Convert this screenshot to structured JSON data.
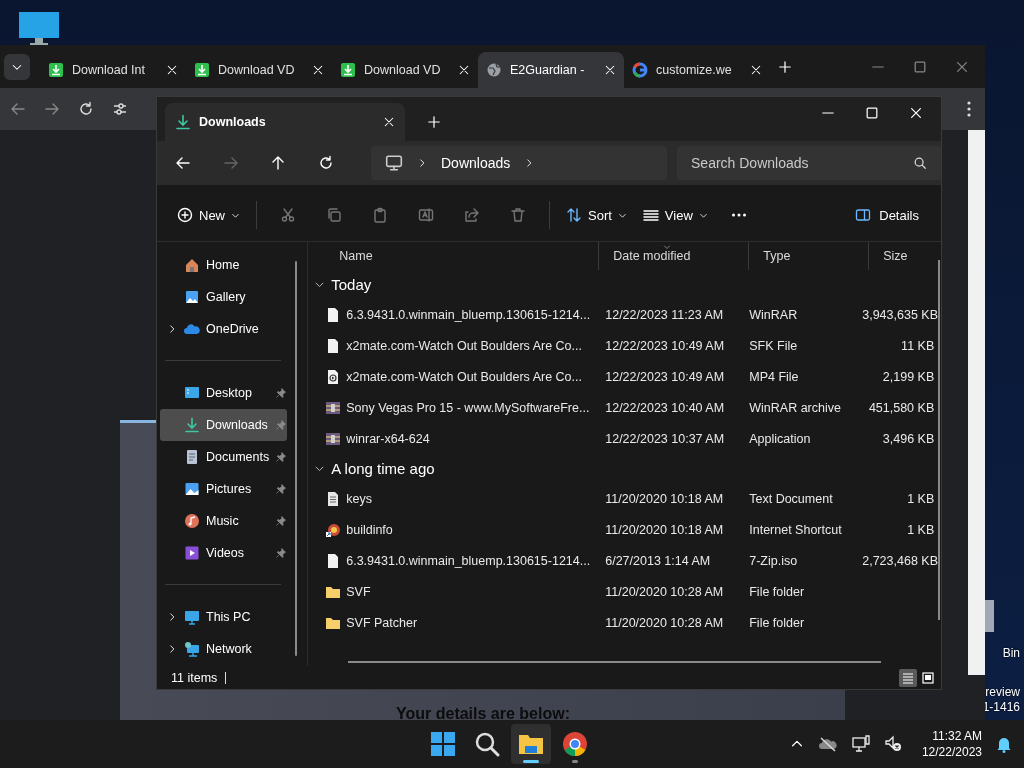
{
  "desktop": {
    "icon_labels": [
      "Bin",
      "review",
      "1-1416"
    ]
  },
  "browser": {
    "tabs": [
      {
        "title": "Download Int",
        "kind": "download",
        "selected": false
      },
      {
        "title": "Download VD",
        "kind": "download",
        "selected": false
      },
      {
        "title": "Download VD",
        "kind": "download",
        "selected": false
      },
      {
        "title": "E2Guardian - ",
        "kind": "globe",
        "selected": true
      },
      {
        "title": "customize.we",
        "kind": "google",
        "selected": false
      }
    ],
    "page_text": "Your details are below:"
  },
  "explorer": {
    "tab": {
      "title": "Downloads"
    },
    "breadcrumb": [
      "Downloads"
    ],
    "search": {
      "placeholder": "Search Downloads"
    },
    "command_groups": [
      [
        {
          "kind": "new",
          "label": "New",
          "disabled": false
        }
      ],
      [
        {
          "kind": "cut",
          "disabled": true
        },
        {
          "kind": "copy",
          "disabled": true
        },
        {
          "kind": "paste",
          "disabled": true
        },
        {
          "kind": "rename",
          "disabled": true
        },
        {
          "kind": "share",
          "disabled": true
        },
        {
          "kind": "delete",
          "disabled": true
        }
      ],
      [
        {
          "kind": "sort",
          "label": "Sort",
          "disabled": false
        },
        {
          "kind": "view",
          "label": "View",
          "disabled": false
        },
        {
          "kind": "more",
          "disabled": false
        }
      ]
    ],
    "details_button": {
      "label": "Details"
    },
    "sidebar": [
      [
        {
          "label": "Home",
          "kind": "home",
          "expandable": false,
          "pinned": false,
          "selected": false
        },
        {
          "label": "Gallery",
          "kind": "gallery",
          "expandable": false,
          "pinned": false,
          "selected": false
        },
        {
          "label": "OneDrive",
          "kind": "cloud",
          "expandable": true,
          "pinned": false,
          "selected": false
        }
      ],
      [
        {
          "label": "Desktop",
          "kind": "desktop",
          "expandable": false,
          "pinned": true,
          "selected": false
        },
        {
          "label": "Downloads",
          "kind": "download",
          "expandable": false,
          "pinned": true,
          "selected": true
        },
        {
          "label": "Documents",
          "kind": "documents",
          "expandable": false,
          "pinned": true,
          "selected": false
        },
        {
          "label": "Pictures",
          "kind": "pictures",
          "expandable": false,
          "pinned": true,
          "selected": false
        },
        {
          "label": "Music",
          "kind": "music",
          "expandable": false,
          "pinned": true,
          "selected": false
        },
        {
          "label": "Videos",
          "kind": "videos",
          "expandable": false,
          "pinned": true,
          "selected": false
        }
      ],
      [
        {
          "label": "This PC",
          "kind": "pc",
          "expandable": true,
          "pinned": false,
          "selected": false
        },
        {
          "label": "Network",
          "kind": "network",
          "expandable": true,
          "pinned": false,
          "selected": false
        }
      ]
    ],
    "columns": [
      {
        "label": "Name",
        "sorted": false
      },
      {
        "label": "Date modified",
        "sorted": true
      },
      {
        "label": "Type",
        "sorted": false
      },
      {
        "label": "Size",
        "sorted": false
      }
    ],
    "groups": [
      {
        "label": "Today",
        "expanded": true,
        "rows": [
          {
            "kind": "file",
            "name": "6.3.9431.0.winmain_bluemp.130615-1214...",
            "date": "12/22/2023 11:23 AM",
            "type": "WinRAR",
            "size": "3,943,635 KB"
          },
          {
            "kind": "file",
            "name": "x2mate.com-Watch Out Boulders Are Co...",
            "date": "12/22/2023 10:49 AM",
            "type": "SFK File",
            "size": "11 KB"
          },
          {
            "kind": "video",
            "name": "x2mate.com-Watch Out Boulders Are Co...",
            "date": "12/22/2023 10:49 AM",
            "type": "MP4 File",
            "size": "2,199 KB"
          },
          {
            "kind": "archive",
            "name": "Sony Vegas Pro 15 - www.MySoftwareFre...",
            "date": "12/22/2023 10:40 AM",
            "type": "WinRAR archive",
            "size": "451,580 KB"
          },
          {
            "kind": "archive",
            "name": "winrar-x64-624",
            "date": "12/22/2023 10:37 AM",
            "type": "Application",
            "size": "3,496 KB"
          }
        ]
      },
      {
        "label": "A long time ago",
        "expanded": true,
        "rows": [
          {
            "kind": "text",
            "name": "keys",
            "date": "11/20/2020 10:18 AM",
            "type": "Text Document",
            "size": "1 KB"
          },
          {
            "kind": "shortcut",
            "name": "buildinfo",
            "date": "11/20/2020 10:18 AM",
            "type": "Internet Shortcut",
            "size": "1 KB"
          },
          {
            "kind": "file",
            "name": "6.3.9431.0.winmain_bluemp.130615-1214...",
            "date": "6/27/2013 1:14 AM",
            "type": "7-Zip.iso",
            "size": "2,723,468 KB"
          },
          {
            "kind": "folder",
            "name": "SVF",
            "date": "11/20/2020 10:28 AM",
            "type": "File folder"
          },
          {
            "kind": "folder",
            "name": "SVF Patcher",
            "date": "11/20/2020 10:28 AM",
            "type": "File folder"
          }
        ]
      }
    ],
    "status": "11 items",
    "view_modes": [
      {
        "kind": "details",
        "selected": true
      },
      {
        "kind": "tiles",
        "selected": false
      }
    ]
  },
  "taskbar": {
    "apps": [
      {
        "kind": "start",
        "selected": false
      },
      {
        "kind": "search",
        "selected": false
      },
      {
        "kind": "explorer",
        "selected": true
      },
      {
        "kind": "chrome",
        "selected": false
      }
    ],
    "time": "11:32 AM",
    "date": "12/22/2023"
  }
}
